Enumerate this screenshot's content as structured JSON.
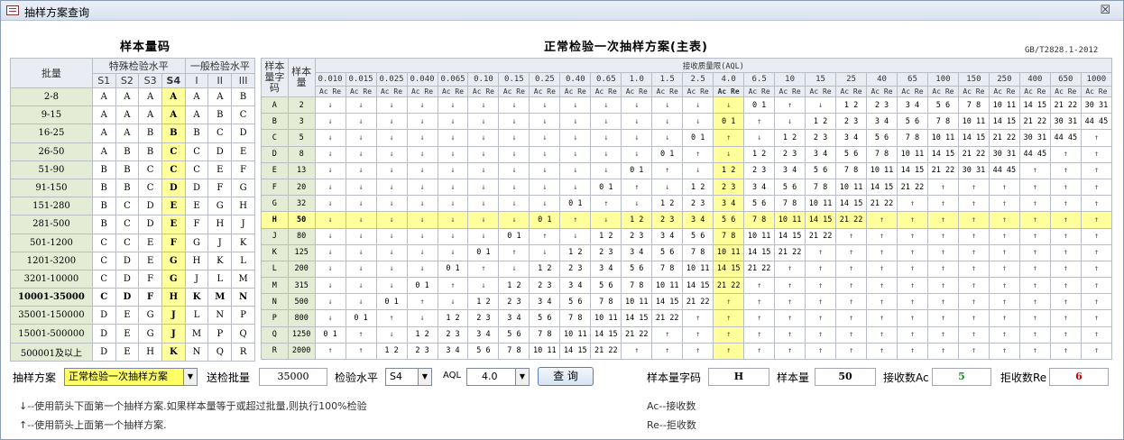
{
  "window": {
    "title": "抽样方案查询",
    "close": "☒"
  },
  "left_title": "样本量码",
  "right_title": "正常检验一次抽样方案(主表)",
  "standard": "GB/T2828.1-2012",
  "left_headers": {
    "lot": "批量",
    "special": "特殊检验水平",
    "general": "一般检验水平",
    "levels": [
      "S1",
      "S2",
      "S3",
      "S4",
      "I",
      "II",
      "III"
    ]
  },
  "left_rows": [
    [
      "2-8",
      "A",
      "A",
      "A",
      "A",
      "A",
      "A",
      "B"
    ],
    [
      "9-15",
      "A",
      "A",
      "A",
      "A",
      "A",
      "B",
      "C"
    ],
    [
      "16-25",
      "A",
      "A",
      "B",
      "B",
      "B",
      "C",
      "D"
    ],
    [
      "26-50",
      "A",
      "B",
      "B",
      "C",
      "C",
      "D",
      "E"
    ],
    [
      "51-90",
      "B",
      "B",
      "C",
      "C",
      "C",
      "E",
      "F"
    ],
    [
      "91-150",
      "B",
      "B",
      "C",
      "D",
      "D",
      "F",
      "G"
    ],
    [
      "151-280",
      "B",
      "C",
      "D",
      "E",
      "E",
      "G",
      "H"
    ],
    [
      "281-500",
      "B",
      "C",
      "D",
      "E",
      "F",
      "H",
      "J"
    ],
    [
      "501-1200",
      "C",
      "C",
      "E",
      "F",
      "G",
      "J",
      "K"
    ],
    [
      "1201-3200",
      "C",
      "D",
      "E",
      "G",
      "H",
      "K",
      "L"
    ],
    [
      "3201-10000",
      "C",
      "D",
      "F",
      "G",
      "J",
      "L",
      "M"
    ],
    [
      "10001-35000",
      "C",
      "D",
      "F",
      "H",
      "K",
      "M",
      "N"
    ],
    [
      "35001-150000",
      "D",
      "E",
      "G",
      "J",
      "L",
      "N",
      "P"
    ],
    [
      "15001-500000",
      "D",
      "E",
      "G",
      "J",
      "M",
      "P",
      "Q"
    ],
    [
      "500001及以上",
      "D",
      "E",
      "H",
      "K",
      "N",
      "Q",
      "R"
    ]
  ],
  "right_headers": {
    "code": "样本量字码",
    "size": "样本量",
    "aql": "接收质量限(AQL)",
    "acre": "Ac Re",
    "aqls": [
      "0.010",
      "0.015",
      "0.025",
      "0.040",
      "0.065",
      "0.10",
      "0.15",
      "0.25",
      "0.40",
      "0.65",
      "1.0",
      "1.5",
      "2.5",
      "4.0",
      "6.5",
      "10",
      "15",
      "25",
      "40",
      "65",
      "100",
      "150",
      "250",
      "400",
      "650",
      "1000"
    ]
  },
  "plan_rows": [
    [
      "A",
      "2",
      "↓",
      "↓",
      "↓",
      "↓",
      "↓",
      "↓",
      "↓",
      "↓",
      "↓",
      "↓",
      "↓",
      "↓",
      "↓",
      "↓",
      "0 1",
      "↑",
      "↓",
      "1 2",
      "2 3",
      "3 4",
      "5 6",
      "7 8",
      "10 11",
      "14 15",
      "21 22",
      "30 31"
    ],
    [
      "B",
      "3",
      "↓",
      "↓",
      "↓",
      "↓",
      "↓",
      "↓",
      "↓",
      "↓",
      "↓",
      "↓",
      "↓",
      "↓",
      "↓",
      "0 1",
      "↑",
      "↓",
      "1 2",
      "2 3",
      "3 4",
      "5 6",
      "7 8",
      "10 11",
      "14 15",
      "21 22",
      "30 31",
      "44 45"
    ],
    [
      "C",
      "5",
      "↓",
      "↓",
      "↓",
      "↓",
      "↓",
      "↓",
      "↓",
      "↓",
      "↓",
      "↓",
      "↓",
      "↓",
      "0 1",
      "↑",
      "↓",
      "1 2",
      "2 3",
      "3 4",
      "5 6",
      "7 8",
      "10 11",
      "14 15",
      "21 22",
      "30 31",
      "44 45",
      "↑"
    ],
    [
      "D",
      "8",
      "↓",
      "↓",
      "↓",
      "↓",
      "↓",
      "↓",
      "↓",
      "↓",
      "↓",
      "↓",
      "↓",
      "0 1",
      "↑",
      "↓",
      "1 2",
      "2 3",
      "3 4",
      "5 6",
      "7 8",
      "10 11",
      "14 15",
      "21 22",
      "30 31",
      "44 45",
      "↑",
      "↑"
    ],
    [
      "E",
      "13",
      "↓",
      "↓",
      "↓",
      "↓",
      "↓",
      "↓",
      "↓",
      "↓",
      "↓",
      "↓",
      "0 1",
      "↑",
      "↓",
      "1 2",
      "2 3",
      "3 4",
      "5 6",
      "7 8",
      "10 11",
      "14 15",
      "21 22",
      "30 31",
      "44 45",
      "↑",
      "↑",
      "↑"
    ],
    [
      "F",
      "20",
      "↓",
      "↓",
      "↓",
      "↓",
      "↓",
      "↓",
      "↓",
      "↓",
      "↓",
      "0 1",
      "↑",
      "↓",
      "1 2",
      "2 3",
      "3 4",
      "5 6",
      "7 8",
      "10 11",
      "14 15",
      "21 22",
      "↑",
      "↑",
      "↑",
      "↑",
      "↑",
      "↑"
    ],
    [
      "G",
      "32",
      "↓",
      "↓",
      "↓",
      "↓",
      "↓",
      "↓",
      "↓",
      "↓",
      "0 1",
      "↑",
      "↓",
      "1 2",
      "2 3",
      "3 4",
      "5 6",
      "7 8",
      "10 11",
      "14 15",
      "21 22",
      "↑",
      "↑",
      "↑",
      "↑",
      "↑",
      "↑",
      "↑"
    ],
    [
      "H",
      "50",
      "↓",
      "↓",
      "↓",
      "↓",
      "↓",
      "↓",
      "↓",
      "0 1",
      "↑",
      "↓",
      "1 2",
      "2 3",
      "3 4",
      "5 6",
      "7 8",
      "10 11",
      "14 15",
      "21 22",
      "↑",
      "↑",
      "↑",
      "↑",
      "↑",
      "↑",
      "↑",
      "↑"
    ],
    [
      "J",
      "80",
      "↓",
      "↓",
      "↓",
      "↓",
      "↓",
      "↓",
      "0 1",
      "↑",
      "↓",
      "1 2",
      "2 3",
      "3 4",
      "5 6",
      "7 8",
      "10 11",
      "14 15",
      "21 22",
      "↑",
      "↑",
      "↑",
      "↑",
      "↑",
      "↑",
      "↑",
      "↑",
      "↑"
    ],
    [
      "K",
      "125",
      "↓",
      "↓",
      "↓",
      "↓",
      "↓",
      "0 1",
      "↑",
      "↓",
      "1 2",
      "2 3",
      "3 4",
      "5 6",
      "7 8",
      "10 11",
      "14 15",
      "21 22",
      "↑",
      "↑",
      "↑",
      "↑",
      "↑",
      "↑",
      "↑",
      "↑",
      "↑",
      "↑"
    ],
    [
      "L",
      "200",
      "↓",
      "↓",
      "↓",
      "↓",
      "0 1",
      "↑",
      "↓",
      "1 2",
      "2 3",
      "3 4",
      "5 6",
      "7 8",
      "10 11",
      "14 15",
      "21 22",
      "↑",
      "↑",
      "↑",
      "↑",
      "↑",
      "↑",
      "↑",
      "↑",
      "↑",
      "↑",
      "↑"
    ],
    [
      "M",
      "315",
      "↓",
      "↓",
      "↓",
      "0 1",
      "↑",
      "↓",
      "1 2",
      "2 3",
      "3 4",
      "5 6",
      "7 8",
      "10 11",
      "14 15",
      "21 22",
      "↑",
      "↑",
      "↑",
      "↑",
      "↑",
      "↑",
      "↑",
      "↑",
      "↑",
      "↑",
      "↑",
      "↑"
    ],
    [
      "N",
      "500",
      "↓",
      "↓",
      "0 1",
      "↑",
      "↓",
      "1 2",
      "2 3",
      "3 4",
      "5 6",
      "7 8",
      "10 11",
      "14 15",
      "21 22",
      "↑",
      "↑",
      "↑",
      "↑",
      "↑",
      "↑",
      "↑",
      "↑",
      "↑",
      "↑",
      "↑",
      "↑",
      "↑"
    ],
    [
      "P",
      "800",
      "↓",
      "0 1",
      "↑",
      "↓",
      "1 2",
      "2 3",
      "3 4",
      "5 6",
      "7 8",
      "10 11",
      "14 15",
      "21 22",
      "↑",
      "↑",
      "↑",
      "↑",
      "↑",
      "↑",
      "↑",
      "↑",
      "↑",
      "↑",
      "↑",
      "↑",
      "↑",
      "↑"
    ],
    [
      "Q",
      "1250",
      "0 1",
      "↑",
      "↓",
      "1 2",
      "2 3",
      "3 4",
      "5 6",
      "7 8",
      "10 11",
      "14 15",
      "21 22",
      "↑",
      "↑",
      "↑",
      "↑",
      "↑",
      "↑",
      "↑",
      "↑",
      "↑",
      "↑",
      "↑",
      "↑",
      "↑",
      "↑",
      "↑"
    ],
    [
      "R",
      "2000",
      "↑",
      "↑",
      "1 2",
      "2 3",
      "3 4",
      "5 6",
      "7 8",
      "10 11",
      "14 15",
      "21 22",
      "↑",
      "↑",
      "↑",
      "↑",
      "↑",
      "↑",
      "↑",
      "↑",
      "↑",
      "↑",
      "↑",
      "↑",
      "↑",
      "↑",
      "↑",
      "↑"
    ]
  ],
  "selected_row": "H",
  "selected_aql_index": 13,
  "controls": {
    "scheme_label": "抽样方案",
    "scheme_value": "正常检验一次抽样方案",
    "lot_label": "送检批量",
    "lot_value": "35000",
    "level_label": "检验水平",
    "level_value": "S4",
    "aql_label": "AQL",
    "aql_value": "4.0",
    "query_label": "查 询",
    "code_label": "样本量字码",
    "code_value": "H",
    "size_label": "样本量",
    "size_value": "50",
    "ac_label": "接收数Ac",
    "ac_value": "5",
    "re_label": "拒收数Re",
    "re_value": "6",
    "ac_color": "#1a8f2e",
    "re_color": "#cc0000"
  },
  "notes": {
    "down": "↓--使用箭头下面第一个抽样方案.如果样本量等于或超过批量,则执行100%检验",
    "up": "↑--使用箭头上面第一个抽样方案.",
    "ac": "Ac--接收数",
    "re": "Re--拒收数"
  }
}
